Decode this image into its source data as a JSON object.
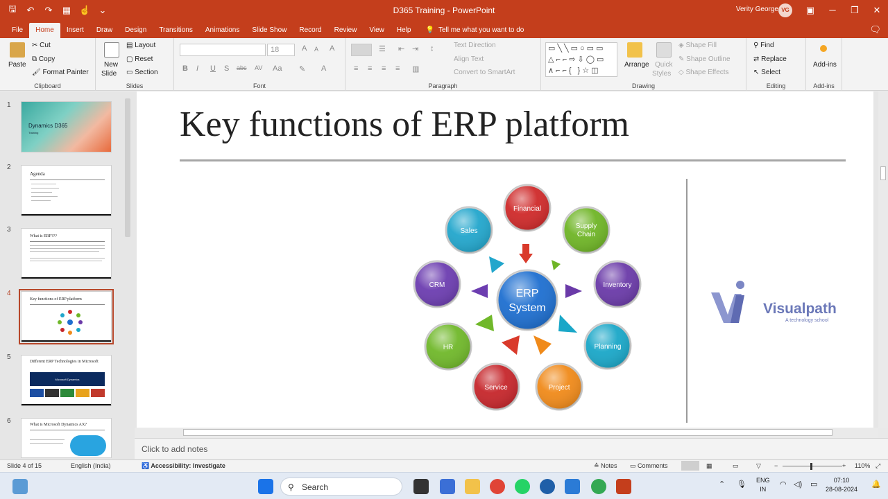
{
  "window": {
    "title": "D365 Training  -  PowerPoint",
    "user": "Verity George",
    "avatar_initials": "VG"
  },
  "tabs": [
    "File",
    "Home",
    "Insert",
    "Draw",
    "Design",
    "Transitions",
    "Animations",
    "Slide Show",
    "Record",
    "Review",
    "View",
    "Help"
  ],
  "active_tab": "Home",
  "tell_me": "Tell me what you want to do",
  "ribbon": {
    "clipboard": {
      "paste": "Paste",
      "cut": "Cut",
      "copy": "Copy",
      "format_painter": "Format Painter",
      "label": "Clipboard"
    },
    "slides": {
      "new_slide": "New",
      "new_slide2": "Slide",
      "layout": "Layout",
      "reset": "Reset",
      "section": "Section",
      "label": "Slides"
    },
    "font": {
      "size": "18",
      "label": "Font"
    },
    "paragraph": {
      "text_direction": "Text Direction",
      "align_text": "Align Text",
      "convert_smartart": "Convert to SmartArt",
      "label": "Paragraph"
    },
    "drawing": {
      "arrange": "Arrange",
      "quick_styles": "Quick",
      "quick_styles2": "Styles",
      "shape_fill": "Shape Fill",
      "shape_outline": "Shape Outline",
      "shape_effects": "Shape Effects",
      "label": "Drawing"
    },
    "editing": {
      "find": "Find",
      "replace": "Replace",
      "select": "Select",
      "label": "Editing"
    },
    "addins": {
      "addins": "Add-ins",
      "label": "Add-ins"
    }
  },
  "thumbnails": [
    {
      "num": "1",
      "title": "Dynamics D365",
      "sub": "Training"
    },
    {
      "num": "2",
      "title": "Agenda"
    },
    {
      "num": "3",
      "title": "What is ERP???"
    },
    {
      "num": "4",
      "title": "Key functions of ERP platform"
    },
    {
      "num": "5",
      "title": "Different ERP Technologies in Microsoft",
      "banner": "Microsoft Dynamics"
    },
    {
      "num": "6",
      "title": "What is Microsoft Dynamics AX?"
    }
  ],
  "slide": {
    "title": "Key functions of ERP platform",
    "center_label_1": "ERP",
    "center_label_2": "System",
    "nodes": [
      "Financial",
      "Supply",
      "Chain",
      "Inventory",
      "Planning",
      "Project",
      "Service",
      "HR",
      "CRM",
      "Sales"
    ],
    "logo_text": "Visualpath",
    "logo_sub": "A technology school"
  },
  "notes_placeholder": "Click to add notes",
  "status": {
    "slide": "Slide 4 of 15",
    "language": "English (India)",
    "accessibility": "Accessibility: Investigate",
    "notes": "Notes",
    "comments": "Comments",
    "zoom": "110%"
  },
  "taskbar": {
    "search": "Search",
    "lang1": "ENG",
    "lang2": "IN",
    "time": "07:10",
    "date": "28-08-2024"
  },
  "colors": {
    "accent": "#c43e1c",
    "financial": "#cf2a2a",
    "supply_chain": "#6fb526",
    "inventory": "#6a3aa8",
    "planning": "#1aa7c8",
    "project": "#f08a1a",
    "service": "#c6262b",
    "hr": "#70b82a",
    "crm": "#6c3db0",
    "sales": "#22a6cc",
    "center": "#1e6fd0"
  }
}
